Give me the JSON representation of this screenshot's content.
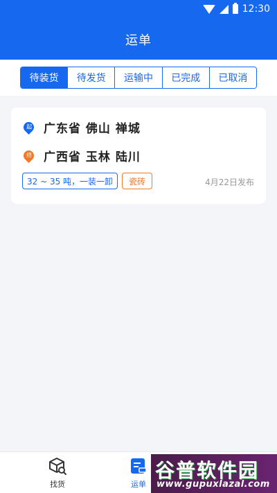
{
  "status_bar": {
    "time": "12:30"
  },
  "header": {
    "title": "运单"
  },
  "tabs": [
    {
      "label": "待装货",
      "active": true
    },
    {
      "label": "待发货",
      "active": false
    },
    {
      "label": "运输中",
      "active": false
    },
    {
      "label": "已完成",
      "active": false
    },
    {
      "label": "已取消",
      "active": false
    }
  ],
  "order": {
    "start": {
      "badge": "起",
      "place": "广东省 佛山 禅城"
    },
    "end": {
      "badge": "终",
      "place": "广西省 玉林 陆川"
    },
    "tags": [
      "32 ~ 35 吨，一装一卸",
      "瓷砖"
    ],
    "publish_date": "4月22日发布"
  },
  "bottom_nav": {
    "items": [
      {
        "label": "找货",
        "icon": "box-search-icon",
        "active": false
      },
      {
        "label": "运单",
        "icon": "waybill-icon",
        "active": true
      }
    ]
  },
  "watermark": {
    "title": "谷普软件园",
    "url": "www.gupuxlazal.com"
  },
  "colors": {
    "primary": "#1668ee",
    "accent": "#f07a2a",
    "background": "#f3f5f9"
  }
}
